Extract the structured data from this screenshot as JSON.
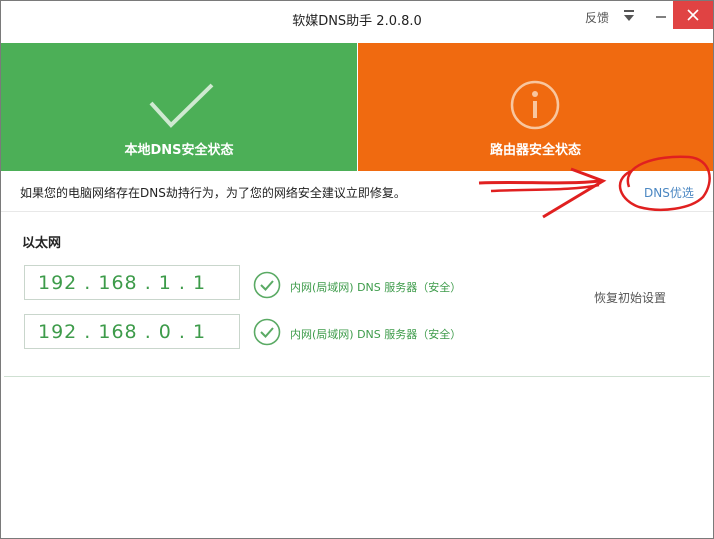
{
  "window": {
    "title": "软媒DNS助手 2.0.8.0",
    "feedback_label": "反馈"
  },
  "tiles": {
    "local": {
      "label": "本地DNS安全状态",
      "color": "#4caf57",
      "icon": "checkmark-icon"
    },
    "router": {
      "label": "路由器安全状态",
      "color": "#f06a10",
      "icon": "info-icon"
    }
  },
  "notice": {
    "text": "如果您的电脑网络存在DNS劫持行为，为了您的网络安全建议立即修复。",
    "link_label": "DNS优选"
  },
  "adapter": {
    "name": "以太网",
    "servers": [
      {
        "ip": "192 . 168 . 1 . 1",
        "status": "内网(局域网) DNS 服务器（安全）"
      },
      {
        "ip": "192 . 168 . 0 . 1",
        "status": "内网(局域网) DNS 服务器（安全）"
      }
    ],
    "restore_label": "恢复初始设置"
  },
  "colors": {
    "safe_green": "#3d9b4a",
    "link_blue": "#4b87c2",
    "close_red": "#e04343"
  }
}
